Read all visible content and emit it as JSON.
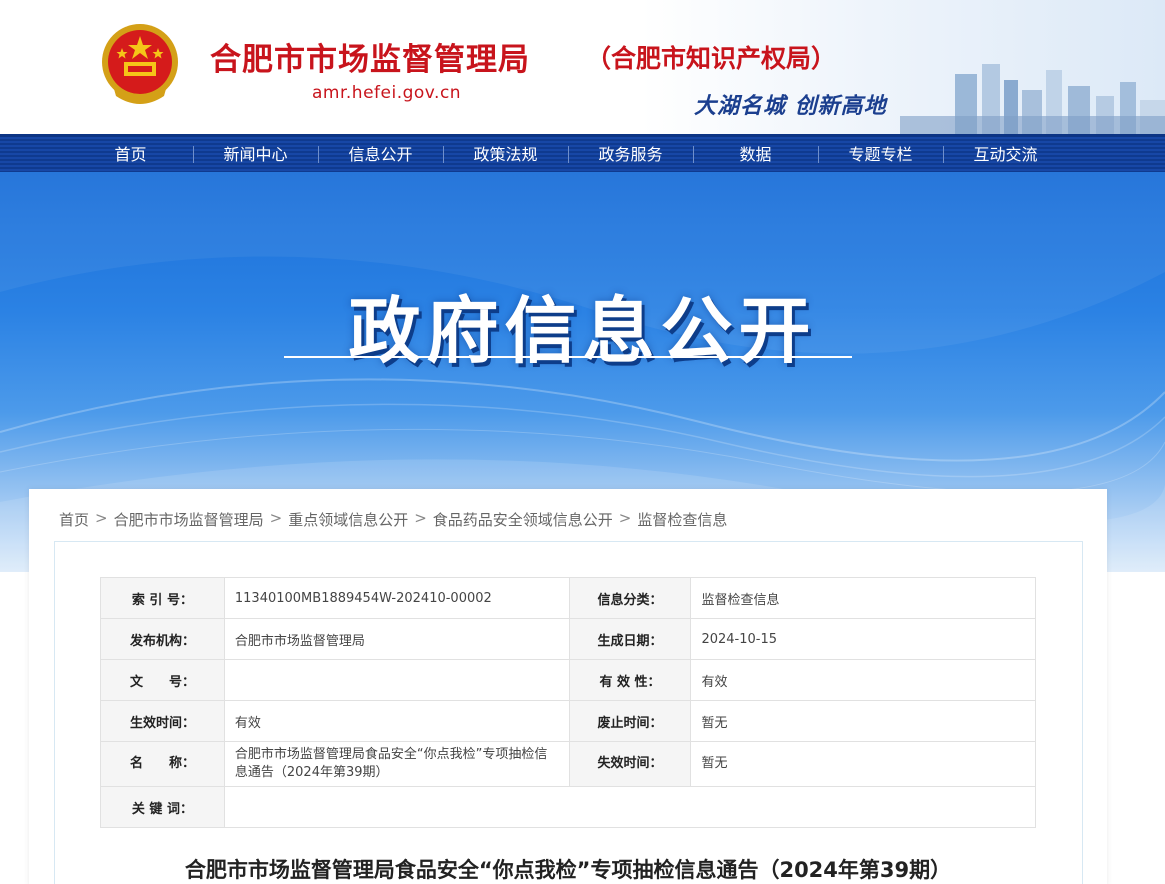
{
  "header": {
    "title": "合肥市市场监督管理局",
    "subtitle": "（合肥市知识产权局）",
    "domain": "amr.hefei.gov.cn",
    "slogan": "大湖名城  创新高地"
  },
  "nav": {
    "items": [
      "首页",
      "新闻中心",
      "信息公开",
      "政策法规",
      "政务服务",
      "数据",
      "专题专栏",
      "互动交流"
    ]
  },
  "banner": {
    "title": "政府信息公开"
  },
  "breadcrumb": {
    "items": [
      "首页",
      "合肥市市场监督管理局",
      "重点领域信息公开",
      "食品药品安全领域信息公开",
      "监督检查信息"
    ],
    "separator": ">"
  },
  "meta": {
    "index_label": "索 引 号：",
    "index_value": "11340100MB1889454W-202410-00002",
    "category_label": "信息分类：",
    "category_value": "监督检查信息",
    "publisher_label": "发布机构：",
    "publisher_value": "合肥市市场监督管理局",
    "date_label": "生成日期：",
    "date_value": "2024-10-15",
    "docno_label": "文　　号：",
    "docno_value": "",
    "validity_label": "有 效 性：",
    "validity_value": "有效",
    "effective_label": "生效时间：",
    "effective_value": "有效",
    "abolish_label": "废止时间：",
    "abolish_value": "暂无",
    "name_label": "名　　称：",
    "name_value": "合肥市市场监督管理局食品安全“你点我检”专项抽检信息通告（2024年第39期）",
    "expire_label": "失效时间：",
    "expire_value": "暂无",
    "keywords_label": "关 键 词：",
    "keywords_value": ""
  },
  "document": {
    "title": "合肥市市场监督管理局食品安全“你点我检”专项抽检信息通告（2024年第39期）"
  },
  "colors": {
    "brand_red": "#c8141c",
    "nav_blue": "#0f3a8f",
    "banner_blue": "#2b82e4"
  }
}
